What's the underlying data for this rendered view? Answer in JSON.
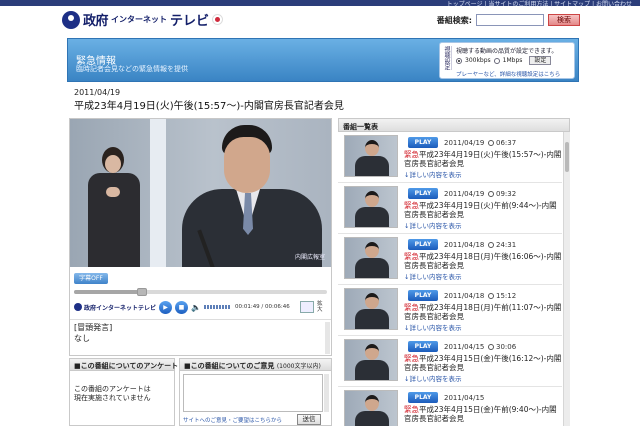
{
  "topbar": {
    "links": "トップページ | 当サイトのご利用方法 | サイトマップ | お問い合わせ"
  },
  "header": {
    "logo_a": "政府",
    "logo_b": "インターネット",
    "logo_c": "テレビ",
    "search_label": "番組検索:",
    "search_value": "",
    "search_button": "検索"
  },
  "banner": {
    "title": "緊急情報",
    "subtitle": "臨時記者会見などの緊急情報を提供",
    "quality": {
      "side_label": "視聴設定",
      "line1": "視聴する動画の品質が設定できます。",
      "opt1": "300kbps",
      "opt2": "1Mbps",
      "set_button": "設定",
      "help_link": "プレーヤーなど、詳細な視聴設定はこちら"
    }
  },
  "program": {
    "date": "2011/04/19",
    "title": "平成23年4月19日(火)午後(15:57〜)-内閣官房長官記者会見"
  },
  "player": {
    "watermark": "内閣広報室",
    "subtitle_toggle": "字幕OFF",
    "logo_text": "政府インターネットテレビ",
    "play_icon": "play-icon",
    "stop_icon": "stop-icon",
    "time": "00:01:49 / 00:06:46",
    "expand_label": "拡大",
    "progress": 0.27,
    "transcript_line1": "[冒頭発言]",
    "transcript_line2": "なし"
  },
  "survey": {
    "header": "■この番組についてのアンケート",
    "line1": "この番組のアンケートは",
    "line2": "現在実施されていません"
  },
  "opinion": {
    "header": "■この番組についてのご意見",
    "limit": "(1000文字以内)",
    "link": "サイトへのご意見・ご要望はこちらから",
    "send": "送信"
  },
  "list": {
    "header": "番組一覧表",
    "play_label": "PLAY",
    "more_label": "詳しい内容を表示",
    "items": [
      {
        "date": "2011/04/19",
        "duration": "06:37",
        "urgent": "緊急",
        "title": "平成23年4月19日(火)午後(15:57〜)-内閣官房長官記者会見"
      },
      {
        "date": "2011/04/19",
        "duration": "09:32",
        "urgent": "緊急",
        "title": "平成23年4月19日(火)午前(9:44〜)-内閣官房長官記者会見"
      },
      {
        "date": "2011/04/18",
        "duration": "24:31",
        "urgent": "緊急",
        "title": "平成23年4月18日(月)午後(16:06〜)-内閣官房長官記者会見"
      },
      {
        "date": "2011/04/18",
        "duration": "15:12",
        "urgent": "緊急",
        "title": "平成23年4月18日(月)午前(11:07〜)-内閣官房長官記者会見"
      },
      {
        "date": "2011/04/15",
        "duration": "30:06",
        "urgent": "緊急",
        "title": "平成23年4月15日(金)午後(16:12〜)-内閣官房長官記者会見"
      },
      {
        "date": "2011/04/15",
        "duration": "",
        "urgent": "緊急",
        "title": "平成23年4月15日(金)午前(9:40〜)-内閣官房長官記者会見"
      }
    ]
  }
}
